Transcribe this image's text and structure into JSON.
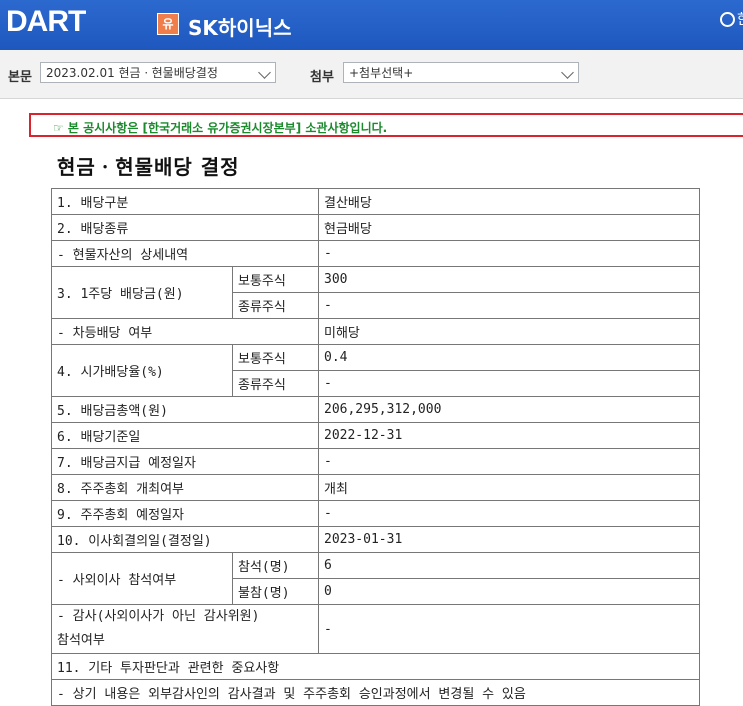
{
  "header": {
    "logo": "DART",
    "badge": "유",
    "company": "SK하이닉스",
    "radio_label": "한"
  },
  "selector_bar": {
    "body_label": "본문",
    "body_value": "2023.02.01  현금ㆍ현물배당결정",
    "attach_label": "첨부",
    "attach_value": "+첨부선택+"
  },
  "notice": "☞ 본 공시사항은 [한국거래소 유가증권시장본부] 소관사항입니다.",
  "doc_title": "현금ㆍ현물배당 결정",
  "rows": {
    "r1": {
      "label": "1. 배당구분",
      "value": "결산배당"
    },
    "r2": {
      "label": "2. 배당종류",
      "value": "현금배당"
    },
    "r3": {
      "label": "- 현물자산의 상세내역",
      "value": "-"
    },
    "r4": {
      "label": "3. 1주당 배당금(원)",
      "sub1": "보통주식",
      "val1": "300",
      "sub2": "종류주식",
      "val2": "-"
    },
    "r5": {
      "label": "- 차등배당 여부",
      "value": "미해당"
    },
    "r6": {
      "label": "4. 시가배당율(%)",
      "sub1": "보통주식",
      "val1": "0.4",
      "sub2": "종류주식",
      "val2": "-"
    },
    "r7": {
      "label": "5. 배당금총액(원)",
      "value": "206,295,312,000"
    },
    "r8": {
      "label": "6. 배당기준일",
      "value": "2022-12-31"
    },
    "r9": {
      "label": "7. 배당금지급 예정일자",
      "value": "-"
    },
    "r10": {
      "label": "8. 주주총회 개최여부",
      "value": "개최"
    },
    "r11": {
      "label": "9. 주주총회 예정일자",
      "value": "-"
    },
    "r12": {
      "label": "10. 이사회결의일(결정일)",
      "value": "2023-01-31"
    },
    "r13": {
      "label": "- 사외이사 참석여부",
      "sub1": "참석(명)",
      "val1": "6",
      "sub2": "불참(명)",
      "val2": "0"
    },
    "r14": {
      "label_line1": "- 감사(사외이사가 아닌 감사위원)",
      "label_line2": "참석여부",
      "value": "-"
    },
    "r15": {
      "label": "11. 기타 투자판단과 관련한 중요사항"
    },
    "r16": {
      "partial": "- 상기 내용은 외부감사인의 감사결과 및 주주총회 승인과정에서 변경될 수 있음"
    }
  },
  "colors": {
    "header_blue": "#2462c7",
    "notice_border": "#d9232d",
    "notice_text": "#1a8a2c",
    "badge_orange": "#f07e4a"
  }
}
